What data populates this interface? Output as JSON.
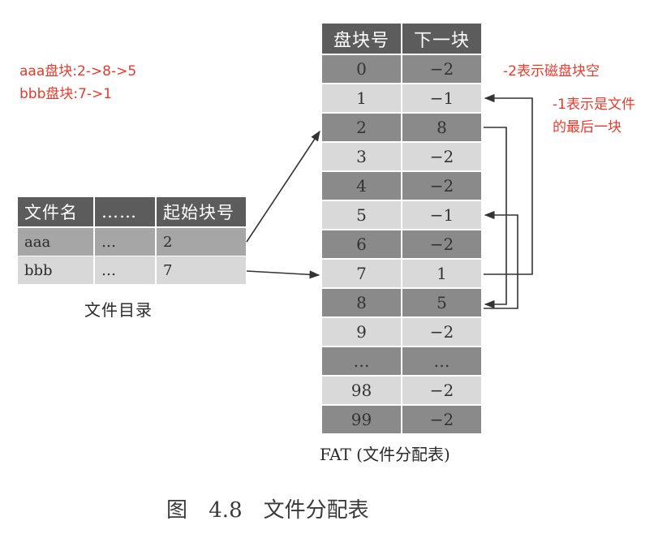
{
  "annotations": {
    "aaa_chain": "aaa盘块:2->8->5",
    "bbb_chain": "bbb盘块:7->1",
    "minus_two_note": "-2表示磁盘块空",
    "minus_one_note_line1": "-1表示是文件",
    "minus_one_note_line2": "的最后一块"
  },
  "directory": {
    "headers": [
      "文件名",
      "……",
      "起始块号"
    ],
    "rows": [
      [
        "aaa",
        "…",
        "2"
      ],
      [
        "bbb",
        "…",
        "7"
      ]
    ],
    "caption": "文件目录"
  },
  "fat": {
    "headers": [
      "盘块号",
      "下一块"
    ],
    "rows": [
      [
        "0",
        "−2"
      ],
      [
        "1",
        "−1"
      ],
      [
        "2",
        "8"
      ],
      [
        "3",
        "−2"
      ],
      [
        "4",
        "−2"
      ],
      [
        "5",
        "−1"
      ],
      [
        "6",
        "−2"
      ],
      [
        "7",
        "1"
      ],
      [
        "8",
        "5"
      ],
      [
        "9",
        "−2"
      ],
      [
        "…",
        "…"
      ],
      [
        "98",
        "−2"
      ],
      [
        "99",
        "−2"
      ]
    ],
    "caption": "FAT (文件分配表)"
  },
  "figure_caption": "图 4.8　文件分配表",
  "colors": {
    "annotation": "#e83a2c",
    "header_bg": "#5c5c5c",
    "row_dark": "#8a8a8a",
    "row_light": "#d9d9d9",
    "arrow": "#333333"
  }
}
